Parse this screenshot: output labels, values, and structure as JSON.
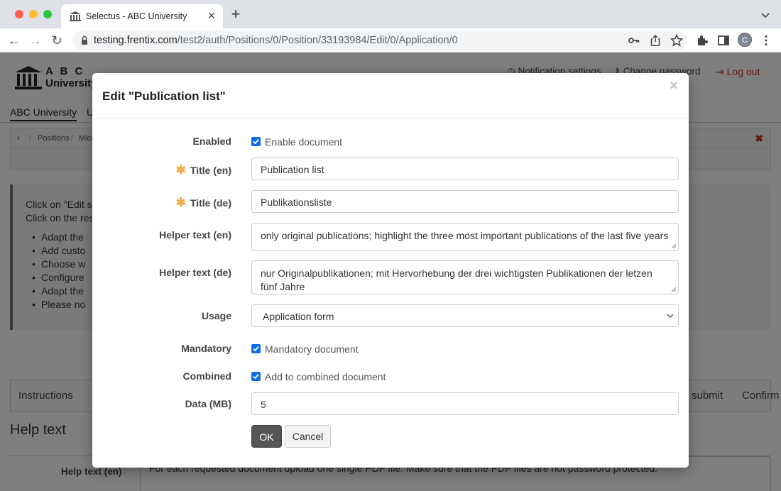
{
  "browser": {
    "tab_title": "Selectus - ABC University",
    "url_host": "testing.frentix.com",
    "url_path": "/test2/auth/Positions/0/Position/33193984/Edit/0/Application/0",
    "avatar_letter": "C"
  },
  "page": {
    "logo_line1": "A B C",
    "logo_line2": "University",
    "notification_settings": "Notification settings",
    "change_password": "Change password",
    "logout": "Log out",
    "nav_active": "ABC University",
    "nav_next": "Us",
    "breadcrumb": [
      "Positions",
      "Micr"
    ],
    "info_lines": [
      "Click on \"Edit st",
      "Click on the resp"
    ],
    "info_items": [
      "Adapt the",
      "Add custo",
      "Choose w",
      "Configure",
      "Adapt the",
      "Please no"
    ],
    "steps": {
      "first": "Instructions",
      "submit": "submit",
      "confirm": "Confirm"
    },
    "help_title": "Help text",
    "help_label": "Help text (en)",
    "help_text": "For each requested document upload one single PDF file. Make sure that the PDF files are not password protected."
  },
  "modal": {
    "title": "Edit \"Publication list\"",
    "close_glyph": "×",
    "fields": {
      "enabled_label": "Enabled",
      "enabled_text": "Enable document",
      "title_en_label": "Title (en)",
      "title_en_value": "Publication list",
      "title_de_label": "Title (de)",
      "title_de_value": "Publikationsliste",
      "helper_en_label": "Helper text (en)",
      "helper_en_value": "only original publications; highlight the three most important publications of the last five years",
      "helper_de_label": "Helper text (de)",
      "helper_de_value": "nur Originalpublikationen; mit Hervorhebung der drei wichtigsten Publikationen der letzen fünf Jahre",
      "usage_label": "Usage",
      "usage_value": "Application form",
      "mandatory_label": "Mandatory",
      "mandatory_text": "Mandatory document",
      "combined_label": "Combined",
      "combined_text": "Add to combined document",
      "data_label": "Data (MB)",
      "data_value": "5",
      "required_mark": "✱"
    },
    "ok_label": "OK",
    "cancel_label": "Cancel"
  },
  "colors": {
    "accent": "#0b6ee8",
    "required": "#f0ad4e",
    "logout": "#c9302c",
    "primary_button": "#555555"
  }
}
